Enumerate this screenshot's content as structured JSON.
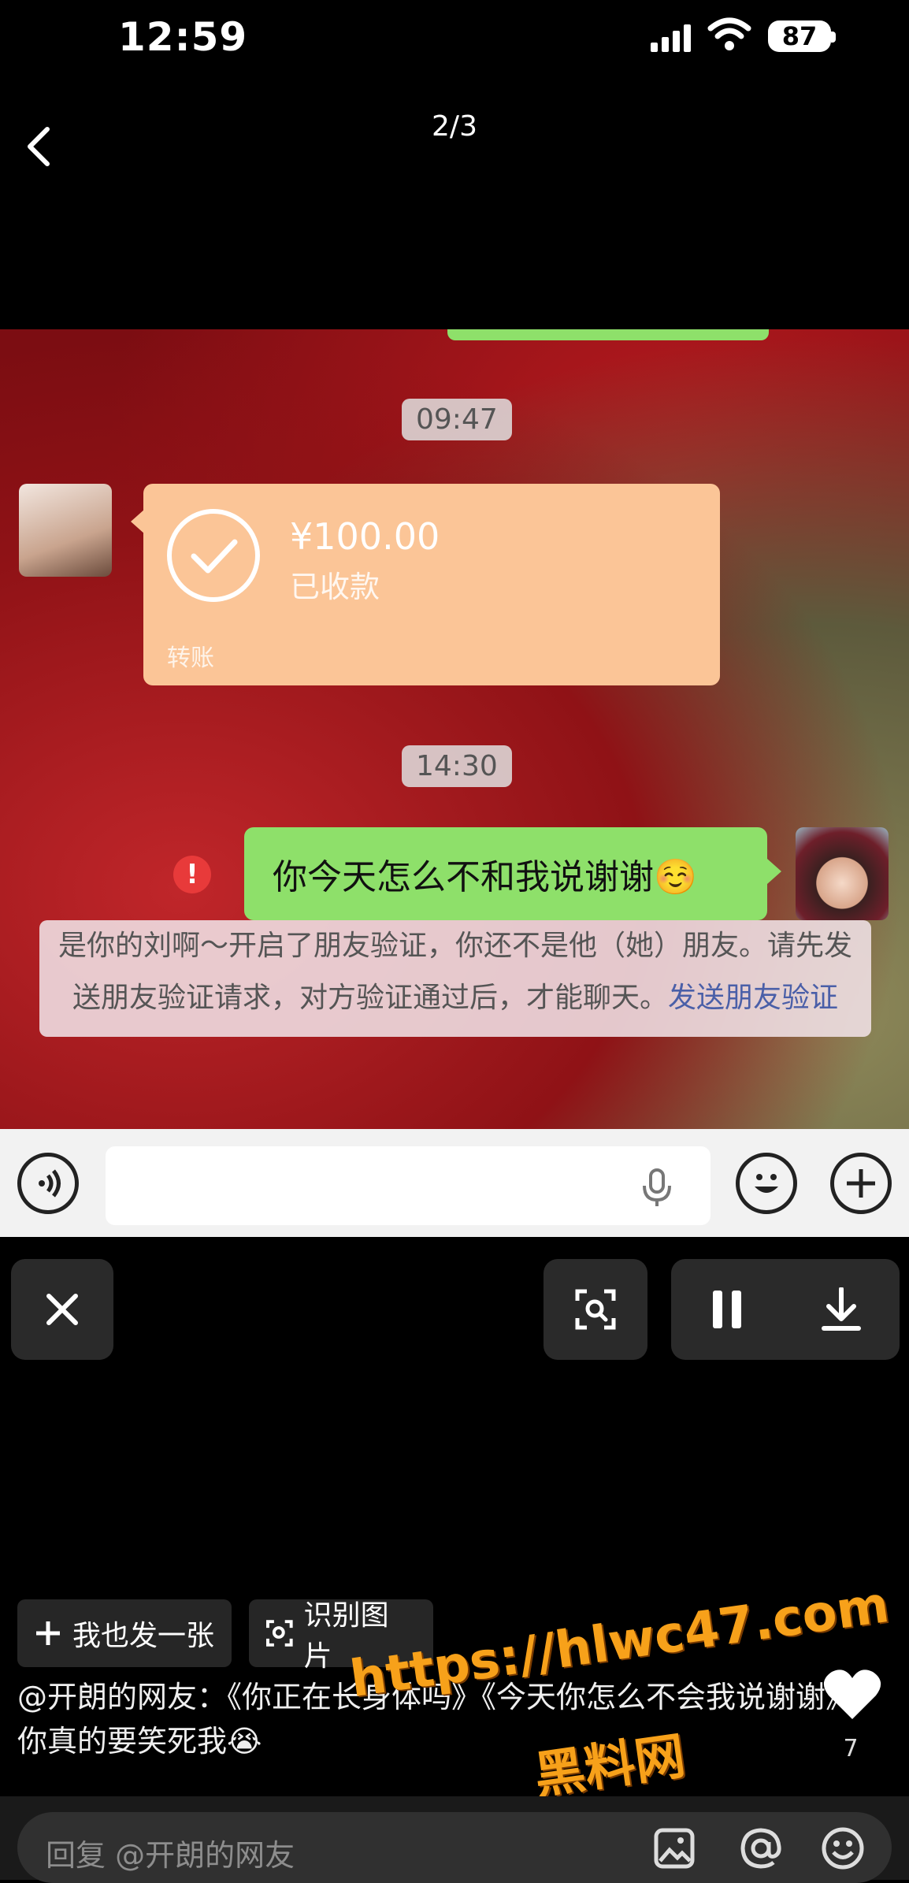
{
  "status_bar": {
    "time": "12:59",
    "battery": "87"
  },
  "header": {
    "pager": "2/3"
  },
  "screenshot": {
    "timestamp_1": "09:47",
    "transfer": {
      "amount": "¥100.00",
      "status": "已收款",
      "footer": "转账"
    },
    "timestamp_2": "14:30",
    "message": "你今天怎么不和我说谢谢☺️",
    "error_mark": "!",
    "notice_text": "是你的刘啊～开启了朋友验证，你还不是他（她）朋友。请先发送朋友验证请求，对方验证通过后，才能聊天。",
    "notice_link": "发送朋友验证"
  },
  "actions": {
    "post_label": "我也发一张",
    "recognize_label": "识别图片"
  },
  "post": {
    "caption": "@开朗的网友：《你正在长身体吗》《今天你怎么不会我说谢谢》你真的要笑死我😭",
    "likes": "7"
  },
  "reply": {
    "placeholder": "回复 @开朗的网友"
  },
  "watermark": {
    "line1": "https://hlwc47.com",
    "line2": "黑料网"
  },
  "icons": [
    "back-icon",
    "signal-icon",
    "wifi-icon",
    "check-icon",
    "voice-icon",
    "mic-icon",
    "emoji-icon",
    "plus-icon",
    "close-icon",
    "scan-icon",
    "pause-icon",
    "download-icon",
    "heart-icon",
    "image-icon",
    "at-icon"
  ],
  "colors": {
    "wechat_green": "#8ee06a",
    "transfer_orange": "#fbc597",
    "error_red": "#e83a3a",
    "link_blue": "#4a5fa8"
  }
}
